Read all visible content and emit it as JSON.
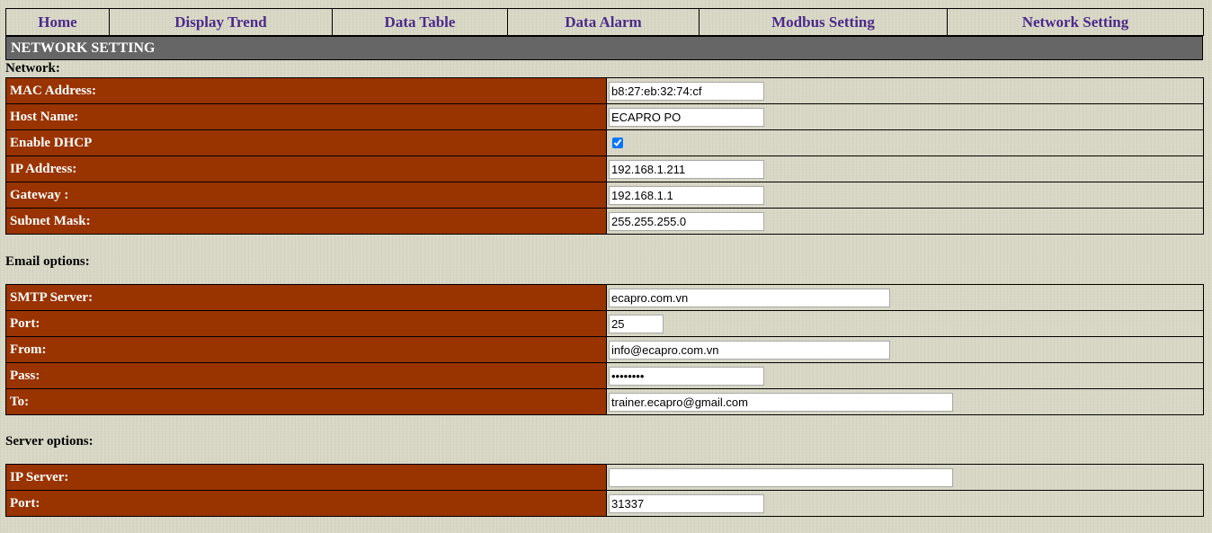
{
  "nav": {
    "items": [
      "Home",
      "Display Trend",
      "Data Table",
      "Data Alarm",
      "Modbus Setting",
      "Network Setting"
    ]
  },
  "section": {
    "title": "NETWORK SETTING"
  },
  "network": {
    "label": "Network:",
    "mac_label": "MAC Address:",
    "mac_value": "b8:27:eb:32:74:cf",
    "host_label": "Host Name:",
    "host_value": "ECAPRO PO",
    "dhcp_label": "Enable DHCP",
    "dhcp_enabled": true,
    "ip_label": "IP Address:",
    "ip_value": "192.168.1.211",
    "gateway_label": "Gateway :",
    "gateway_value": "192.168.1.1",
    "subnet_label": "Subnet Mask:",
    "subnet_value": "255.255.255.0"
  },
  "email": {
    "label": "Email options:",
    "smtp_label": "SMTP Server:",
    "smtp_value": "ecapro.com.vn",
    "port_label": "Port:",
    "port_value": "25",
    "from_label": "From:",
    "from_value": "info@ecapro.com.vn",
    "pass_label": "Pass:",
    "pass_value": "password",
    "to_label": "To:",
    "to_value": "trainer.ecapro@gmail.com"
  },
  "server": {
    "label": "Server options:",
    "ip_label": "IP Server:",
    "ip_value": "",
    "port_label": "Port:",
    "port_value": "31337"
  },
  "colors": {
    "nav_text": "#4b2a8a",
    "label_bg": "#993300",
    "header_bg": "#666666"
  }
}
